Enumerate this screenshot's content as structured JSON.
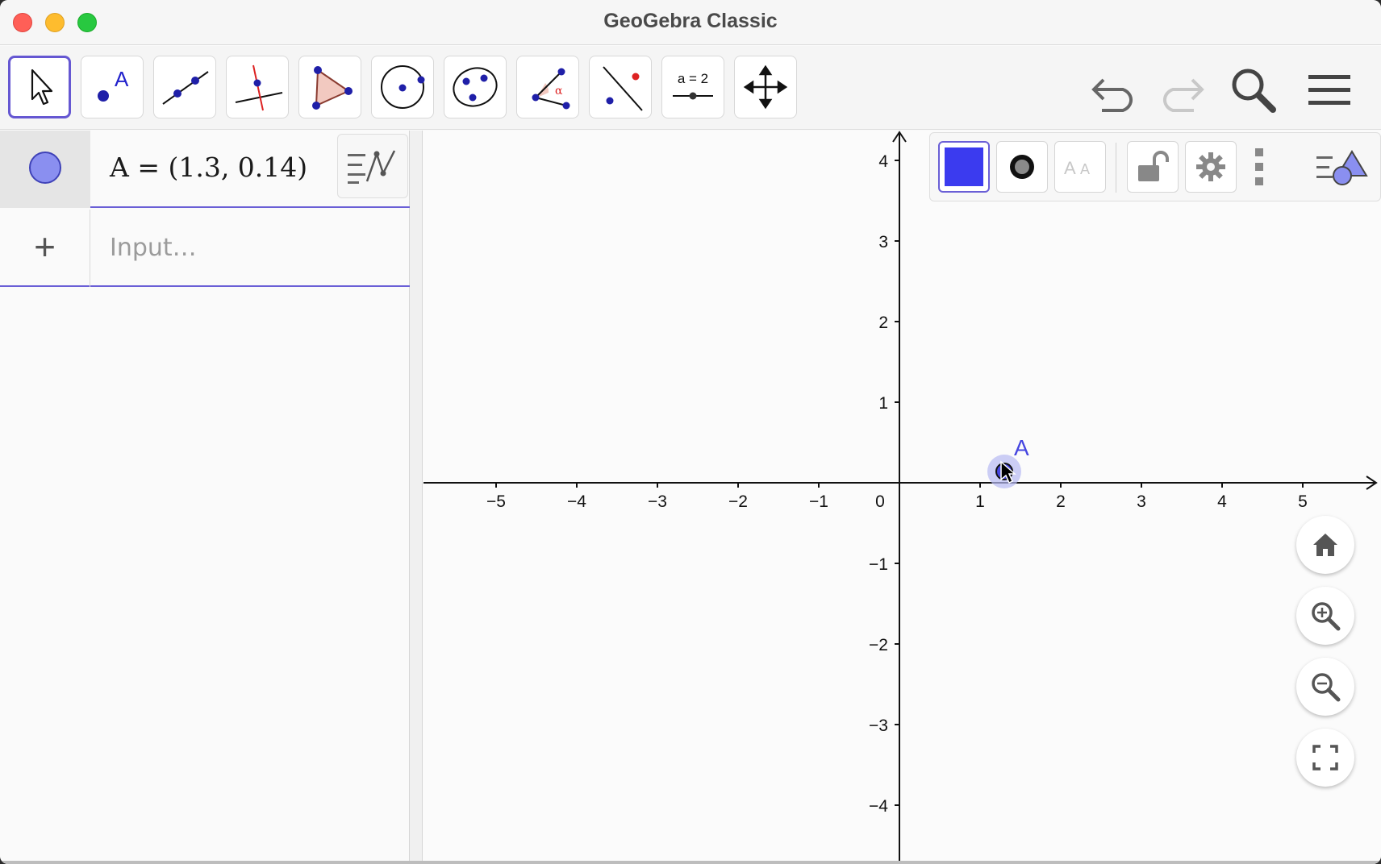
{
  "window": {
    "title": "GeoGebra Classic"
  },
  "toolbar": {
    "tools": [
      {
        "name": "move-tool",
        "icon": "arrow-pointer-icon",
        "active": true
      },
      {
        "name": "point-tool",
        "icon": "point-icon",
        "label": "A"
      },
      {
        "name": "line-tool",
        "icon": "line-through-points-icon"
      },
      {
        "name": "perpendicular-line-tool",
        "icon": "perpendicular-line-icon"
      },
      {
        "name": "polygon-tool",
        "icon": "polygon-icon"
      },
      {
        "name": "circle-tool",
        "icon": "circle-center-point-icon"
      },
      {
        "name": "conic-tool",
        "icon": "ellipse-icon"
      },
      {
        "name": "angle-tool",
        "icon": "angle-icon",
        "label": "α"
      },
      {
        "name": "reflect-tool",
        "icon": "reflect-about-line-icon"
      },
      {
        "name": "slider-tool",
        "icon": "slider-icon",
        "label": "a = 2"
      },
      {
        "name": "move-graphics-tool",
        "icon": "move-graphics-icon"
      }
    ],
    "undo_icon": "undo-icon",
    "redo_icon": "redo-icon",
    "search_icon": "search-icon",
    "menu_icon": "hamburger-menu-icon"
  },
  "algebra": {
    "items": [
      {
        "label": "A = (1.3, 0.14)",
        "color": "#3f42b8"
      }
    ],
    "input_placeholder": "Input…"
  },
  "graphics": {
    "x_ticks": [
      "−5",
      "−4",
      "−3",
      "−2",
      "−1",
      "0",
      "1",
      "2",
      "3",
      "4",
      "5"
    ],
    "y_ticks": [
      "4",
      "3",
      "2",
      "1",
      "−1",
      "−2",
      "−3",
      "−4"
    ],
    "point": {
      "name": "A",
      "x": 1.3,
      "y": 0.14,
      "color": "#4646e0"
    },
    "style_bar": {
      "color_swatch": "#3b3bef",
      "point_style_icon": "point-style-icon",
      "label_style_icon": "label-style-icon",
      "lock_icon": "unlock-icon",
      "settings_icon": "gear-icon",
      "more_icon": "more-vertical-icon",
      "toggle_icon": "style-bar-toggle-icon"
    },
    "buttons": {
      "home": "home-icon",
      "zoom_in": "zoom-in-icon",
      "zoom_out": "zoom-out-icon",
      "fullscreen": "fullscreen-icon"
    }
  }
}
